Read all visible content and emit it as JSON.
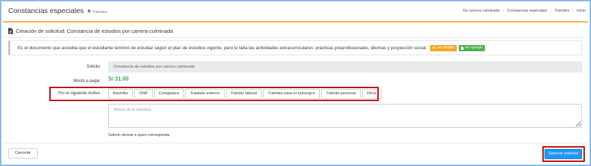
{
  "header": {
    "title": "Constancias especiales",
    "subtitle": "Trámites",
    "separator": "/",
    "breadcrumb": [
      "De carrera culminada",
      "Constancias especiales",
      "Trámites",
      "Inicio"
    ]
  },
  "section": {
    "title": "Creación de solicitud: Constancia de estudios por carrera culminada"
  },
  "description": {
    "text": "Es el documento que acredita que el estudiante terminó de estudiar según el plan de estudios vigente, pero le falta las actividades extracurriculares: prácticas preprofesionales, idiomas y proyección social.",
    "details_button": "ver detalles",
    "example_button": "ver ejemplo"
  },
  "form": {
    "request_label": "Solicito",
    "request_value": "Constancia de estudios por carrera culminada",
    "amount_label": "Monto a pagar",
    "amount_value": "S/ 31.00",
    "reason_label": "Por el siguiente motivo",
    "reasons": [
      "Bachiller",
      "ONP",
      "Colegiatura",
      "Traslado externo",
      "Trámite laboral",
      "Trámites para el extranjero",
      "Trámite personal",
      "Otros"
    ],
    "reason_placeholder": "Motivo de la solicitud...",
    "note": "Solicito derivar a quien corresponda."
  },
  "actions": {
    "cancel": "Cancelar",
    "submit": "Generar solicitud"
  },
  "icons": {
    "subtitle": "home-icon",
    "section": "file-text-icon",
    "details_button": "eye-icon",
    "example_button": "file-icon"
  },
  "colors": {
    "accent_line": "#f0b43a",
    "amount": "#38a84a",
    "details_button": "#f5a51c",
    "example_button": "#4cae4c",
    "submit_button": "#2196f3",
    "highlight": "#c40000"
  }
}
